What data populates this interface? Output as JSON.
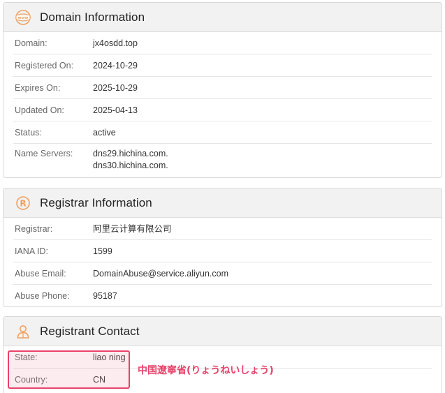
{
  "domain_info": {
    "title": "Domain Information",
    "icon": "www-globe-icon",
    "rows": [
      {
        "label": "Domain:",
        "value": "jx4osdd.top"
      },
      {
        "label": "Registered On:",
        "value": "2024-10-29"
      },
      {
        "label": "Expires On:",
        "value": "2025-10-29"
      },
      {
        "label": "Updated On:",
        "value": "2025-04-13"
      },
      {
        "label": "Status:",
        "value": "active"
      }
    ],
    "name_servers": {
      "label": "Name Servers:",
      "values": [
        "dns29.hichina.com.",
        "dns30.hichina.com."
      ]
    }
  },
  "registrar_info": {
    "title": "Registrar Information",
    "icon": "registered-icon",
    "rows": [
      {
        "label": "Registrar:",
        "value": "阿里云计算有限公司"
      },
      {
        "label": "IANA ID:",
        "value": "1599"
      },
      {
        "label": "Abuse Email:",
        "value": "DomainAbuse@service.aliyun.com"
      },
      {
        "label": "Abuse Phone:",
        "value": "95187"
      }
    ]
  },
  "registrant_contact": {
    "title": "Registrant Contact",
    "icon": "person-icon",
    "rows": [
      {
        "label": "State:",
        "value": "liao ning"
      },
      {
        "label": "Country:",
        "value": "CN"
      }
    ]
  },
  "annotation": {
    "text": "中国遼寧省(りょうねいしょう)",
    "color": "#e8426a"
  },
  "colors": {
    "icon_orange": "#f0a060",
    "header_bg": "#f2f2f2"
  }
}
